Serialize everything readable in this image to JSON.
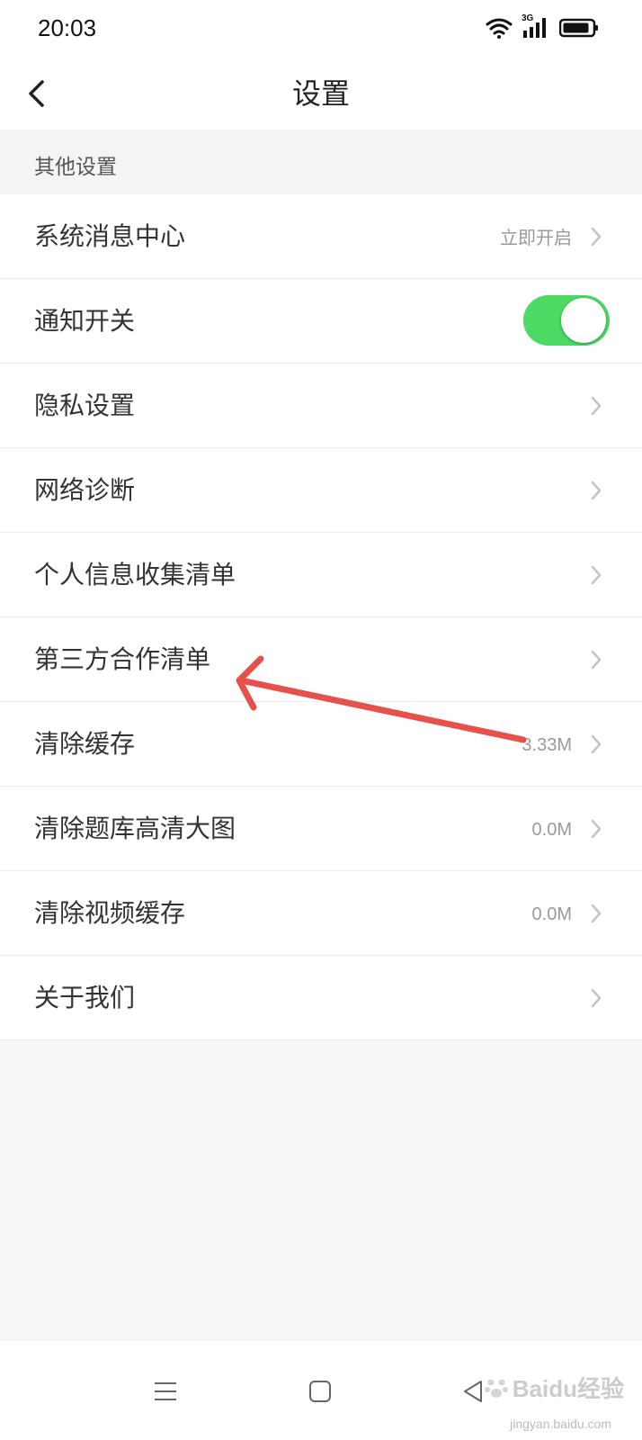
{
  "status_bar": {
    "time": "20:03",
    "network_label": "3G"
  },
  "nav": {
    "title": "设置"
  },
  "section": {
    "title": "其他设置"
  },
  "settings": {
    "items": [
      {
        "label": "系统消息中心",
        "value": "立即开启",
        "control": "chevron"
      },
      {
        "label": "通知开关",
        "value": "",
        "control": "toggle",
        "toggle_on": true
      },
      {
        "label": "隐私设置",
        "value": "",
        "control": "chevron"
      },
      {
        "label": "网络诊断",
        "value": "",
        "control": "chevron"
      },
      {
        "label": "个人信息收集清单",
        "value": "",
        "control": "chevron"
      },
      {
        "label": "第三方合作清单",
        "value": "",
        "control": "chevron"
      },
      {
        "label": "清除缓存",
        "value": "3.33M",
        "control": "chevron"
      },
      {
        "label": "清除题库高清大图",
        "value": "0.0M",
        "control": "chevron"
      },
      {
        "label": "清除视频缓存",
        "value": "0.0M",
        "control": "chevron"
      },
      {
        "label": "关于我们",
        "value": "",
        "control": "chevron"
      }
    ]
  },
  "colors": {
    "toggle_on": "#4cd964",
    "annotation_arrow": "#e8504a",
    "value_text": "#999999"
  },
  "icons": {
    "back": "chevron-left-icon",
    "row_chevron": "chevron-right-icon",
    "menu": "menu-lines-icon",
    "home": "square-home-icon",
    "sys_back": "triangle-back-icon"
  },
  "watermark": {
    "brand": "Baidu经验",
    "url": "jingyan.baidu.com"
  }
}
